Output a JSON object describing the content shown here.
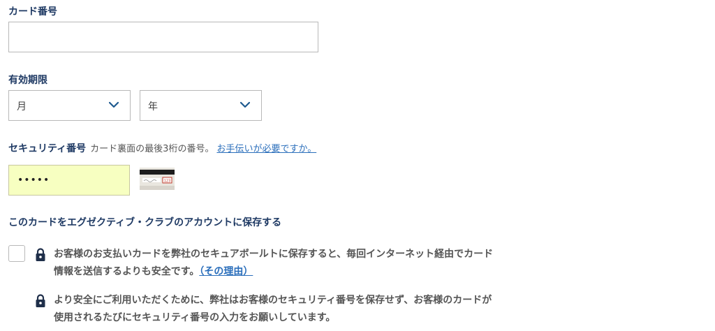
{
  "card_number": {
    "label": "カード番号",
    "value": ""
  },
  "expiry": {
    "label": "有効期限",
    "month_value": "月",
    "year_value": "年"
  },
  "security": {
    "label": "セキュリティ番号",
    "hint": "カード裏面の最後3桁の番号。",
    "help_link": "お手伝いが必要ですか。",
    "value": "•••••"
  },
  "save_card": {
    "title": "このカードをエグゼクティブ・クラブのアカウントに保存する",
    "checked": false,
    "description": "お客様のお支払いカードを弊社のセキュアボールトに保存すると、毎回インターネット経由でカード情報を送信するよりも安全です。",
    "why_link": "（その理由）",
    "note": "より安全にご利用いただくために、弊社はお客様のセキュリティ番号を保存せず、お客様のカードが使用されるたびにセキュリティ番号の入力をお願いしています。"
  },
  "colors": {
    "label": "#1f3a64",
    "link": "#2a6ebb",
    "autofill": "#f7ffc1",
    "chevron": "#1f5a8f"
  },
  "icons": {
    "chevron": "chevron-down-icon",
    "lock": "lock-icon",
    "card": "card-back-icon"
  }
}
